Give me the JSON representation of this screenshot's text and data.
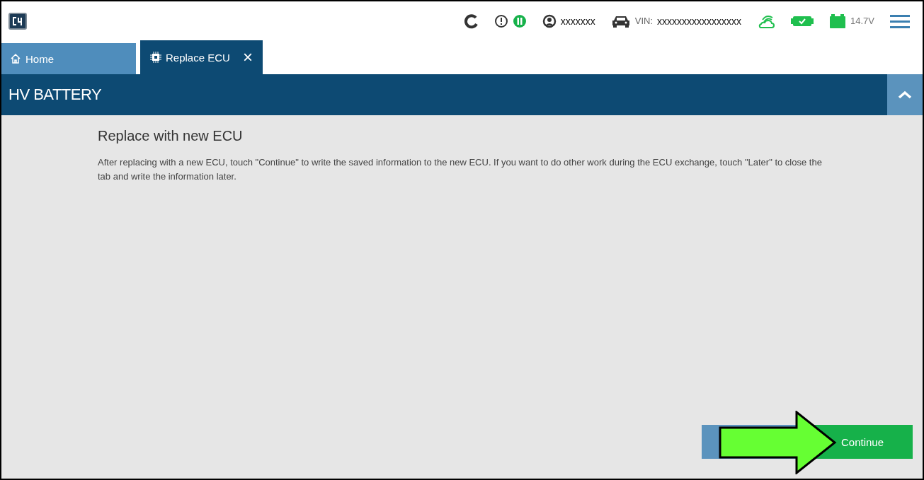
{
  "top_bar": {
    "user": "xxxxxxx",
    "vin_label": "VIN:",
    "vin": "xxxxxxxxxxxxxxxxx",
    "voltage": "14.7V"
  },
  "tabs": [
    {
      "label": "Home",
      "kind": "home",
      "selected": false,
      "closable": false
    },
    {
      "label": "Replace ECU",
      "kind": "ecu",
      "selected": true,
      "closable": true
    }
  ],
  "close_tab": "×",
  "section": {
    "title": "HV BATTERY",
    "expanded": true
  },
  "content": {
    "heading": "Replace with new ECU",
    "text": "After replacing with a new ECU, touch \"Continue\" to write the saved information to the new ECU. If you want to do other work during the ECU exchange, touch \"Later\" to close the tab and write the information later."
  },
  "buttons": [
    {
      "kind": "secondary"
    },
    {
      "kind": "primary",
      "label": "Continue"
    }
  ],
  "annotation": {
    "kind": "arrow"
  }
}
